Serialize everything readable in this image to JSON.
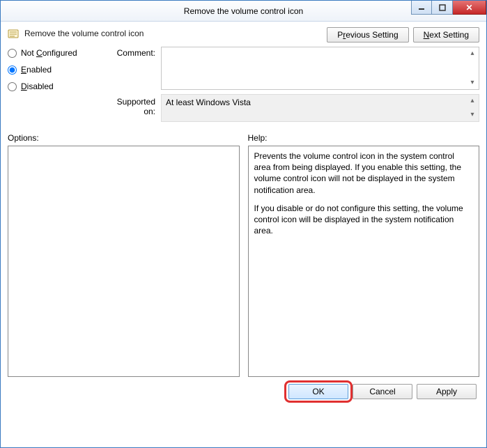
{
  "window": {
    "title": "Remove the volume control icon"
  },
  "header": {
    "policy_title": "Remove the volume control icon",
    "prev_pre": "P",
    "prev_u": "r",
    "prev_post": "evious Setting",
    "next_pre": "",
    "next_u": "N",
    "next_post": "ext Setting"
  },
  "state": {
    "not_configured_pre": "Not ",
    "not_configured_u": "C",
    "not_configured_post": "onfigured",
    "enabled_u": "E",
    "enabled_post": "nabled",
    "disabled_u": "D",
    "disabled_post": "isabled",
    "selected": "enabled"
  },
  "labels": {
    "comment": "Comment:",
    "supported_on": "Supported on:",
    "options": "Options:",
    "help": "Help:"
  },
  "supported_on_value": "At least Windows Vista",
  "help_text": {
    "p1": "Prevents the volume control icon in the system control area from being displayed. If you enable this setting, the volume control icon will not be displayed in the system notification area.",
    "p2": "If you disable or do not configure this setting, the volume control icon will be displayed in the system notification area."
  },
  "footer": {
    "ok": "OK",
    "cancel": "Cancel",
    "apply": "Apply"
  }
}
